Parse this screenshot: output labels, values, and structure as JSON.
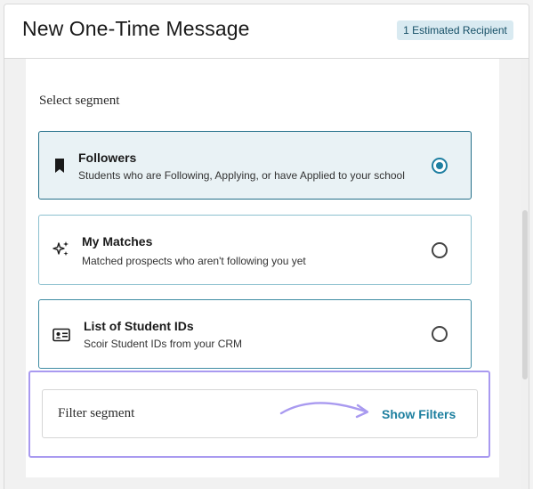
{
  "header": {
    "title": "New One-Time Message",
    "recipient_badge": "1 Estimated Recipient"
  },
  "segment": {
    "label": "Select segment",
    "options": [
      {
        "icon": "bookmark-icon",
        "title": "Followers",
        "description": "Students who are Following, Applying, or have Applied to your school",
        "selected": true
      },
      {
        "icon": "sparkles-icon",
        "title": "My Matches",
        "description": "Matched prospects who aren't following you yet",
        "selected": false
      },
      {
        "icon": "id-card-icon",
        "title": "List of Student IDs",
        "description": "Scoir Student IDs from your CRM",
        "selected": false
      }
    ]
  },
  "filter": {
    "label": "Filter segment",
    "link": "Show Filters"
  },
  "colors": {
    "accent": "#1d7f9f",
    "selected_bg": "#e9f2f5",
    "highlight": "#a99af0",
    "badge_bg": "#d9eaf1"
  }
}
